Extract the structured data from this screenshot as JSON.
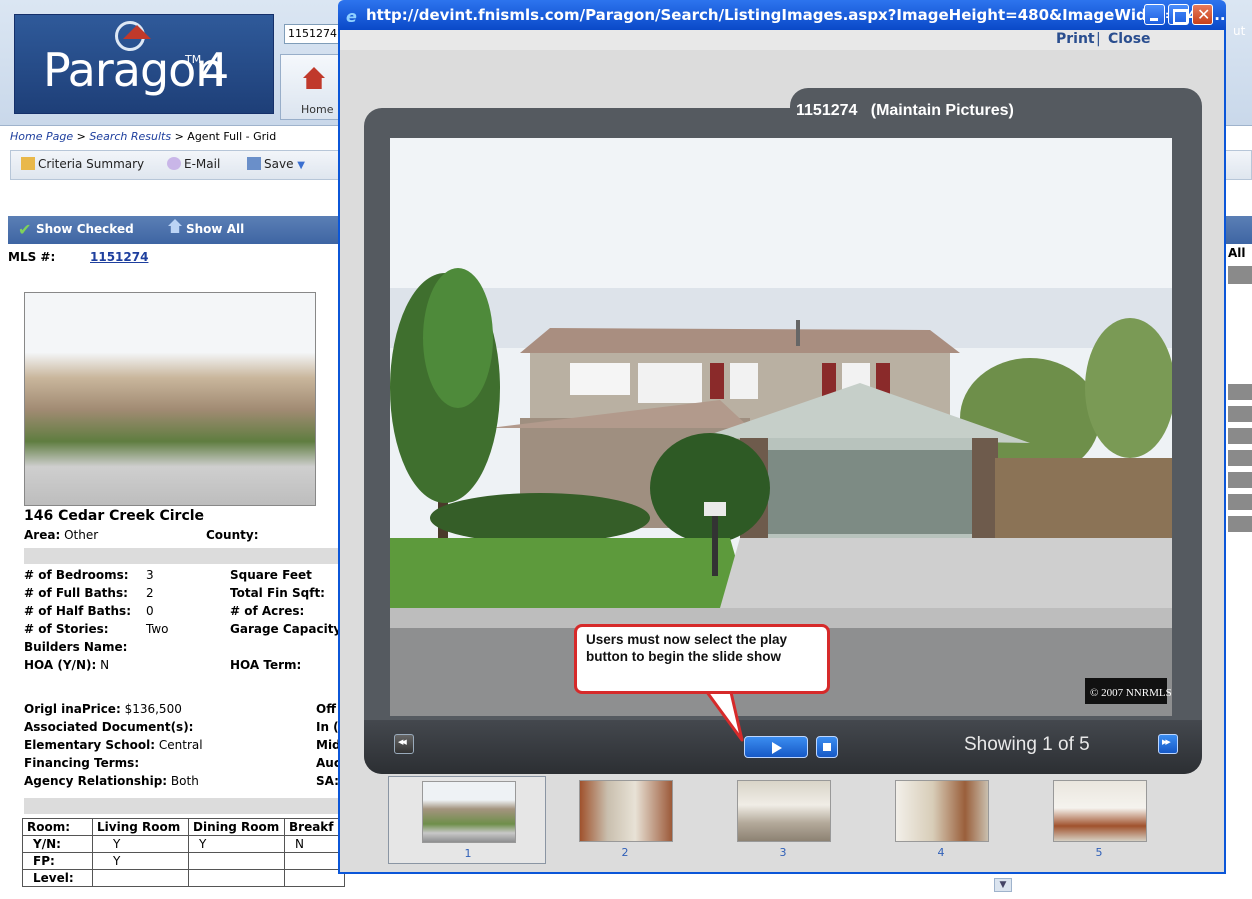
{
  "background": {
    "logo_text": "Paragon",
    "logo_tm": "TM",
    "logo_version": "4",
    "mls_search_value": "1151274",
    "home_button_label": "Home",
    "right_edge_text": "ut",
    "breadcrumb": {
      "home": "Home Page",
      "sep1": " > ",
      "results": "Search Results",
      "sep2": " > ",
      "current": "Agent Full - Grid"
    },
    "toolbar": {
      "criteria_summary": "Criteria Summary",
      "email": "E-Mail",
      "save": "Save"
    },
    "showbar": {
      "show_checked": "Show Checked",
      "show_all": "Show All"
    },
    "right_all": "All",
    "listing": {
      "mls_label": "MLS #:",
      "mls_number": "1151274",
      "address": "146 Cedar Creek Circle",
      "area_label": "Area:",
      "area_value": "Other",
      "county_label": "County:",
      "bedrooms_label": "# of Bedrooms:",
      "bedrooms_value": "3",
      "full_baths_label": "# of Full Baths:",
      "full_baths_value": "2",
      "half_baths_label": "# of Half Baths:",
      "half_baths_value": "0",
      "stories_label": "# of Stories:",
      "stories_value": "Two",
      "builders_label": "Builders Name:",
      "hoa_label": "HOA (Y/N):",
      "hoa_value": "N",
      "square_feet_label": "Square Feet",
      "total_fin_label": "Total Fin Sqft:",
      "acres_label": "# of Acres:",
      "garage_label": "Garage Capacity",
      "hoa_term_label": "HOA Term:",
      "orig_price_label": "Origl inaPrice:",
      "orig_price_value": "$136,500",
      "assoc_docs_label": "Associated Document(s):",
      "elem_school_label": "Elementary School:",
      "elem_school_value": "Central",
      "financing_label": "Financing Terms:",
      "agency_label": "Agency Relationship:",
      "agency_value": "Both",
      "trunc_off": "Off",
      "trunc_in": "In (",
      "trunc_mid": "Mid",
      "trunc_auc": "Auc",
      "trunc_sa": "SA:"
    },
    "room_table": {
      "header": [
        "Room:",
        "Living Room",
        "Dining Room",
        "Breakf"
      ],
      "rows": [
        [
          "Y/N:",
          "Y",
          "Y",
          "N"
        ],
        [
          "FP:",
          "Y",
          "",
          ""
        ],
        [
          "Level:",
          "",
          "",
          ""
        ]
      ]
    }
  },
  "popup": {
    "url": "http://devint.fnismls.com/Paragon/Search/ListingImages.aspx?ImageHeight=480&ImageWidth=640...",
    "print_label": "Print",
    "link_separator": "|",
    "close_label": "Close",
    "viewer_title": "1151274   (Maintain Pictures)",
    "photo_copyright": "© 2007 NNRMLS",
    "showing_text": "Showing 1 of 5",
    "thumbnails": [
      {
        "num": "1",
        "selected": true
      },
      {
        "num": "2",
        "selected": false
      },
      {
        "num": "3",
        "selected": false
      },
      {
        "num": "4",
        "selected": false
      },
      {
        "num": "5",
        "selected": false
      }
    ]
  },
  "callout": {
    "text": "Users must now select the play button to begin the slide show"
  },
  "colors": {
    "titlebar_blue": "#0a49c8",
    "callout_border": "#d62a2a",
    "link_blue": "#2a4e8f",
    "play_blue": "#1659c7"
  },
  "icons": [
    "ie-icon",
    "minimize-icon",
    "maximize-icon",
    "close-icon",
    "previous-icon",
    "play-icon",
    "stop-icon",
    "next-icon",
    "checkmark-icon",
    "home-icon"
  ]
}
